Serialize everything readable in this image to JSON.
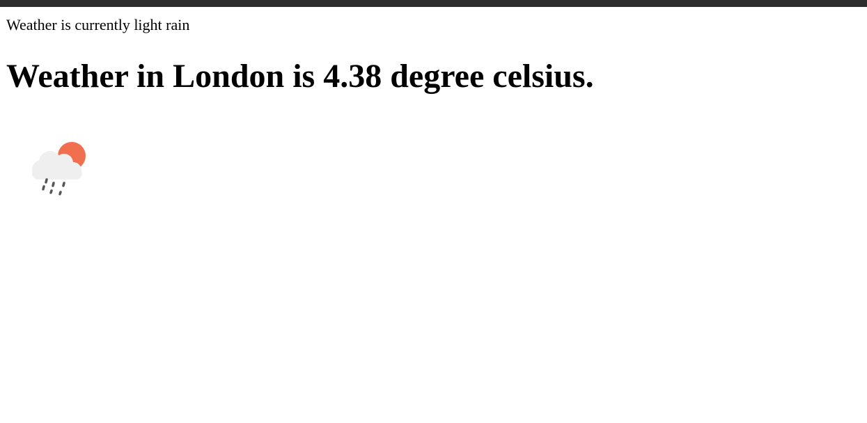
{
  "weather": {
    "description": "Weather is currently light rain",
    "headline": "Weather in London is 4.38 degree celsius.",
    "icon": "partly-cloudy-rain-icon"
  },
  "colors": {
    "top_bar": "#2d2d2d",
    "sun": "#ef6f4f",
    "cloud": "#efefef",
    "rain": "#555555"
  }
}
